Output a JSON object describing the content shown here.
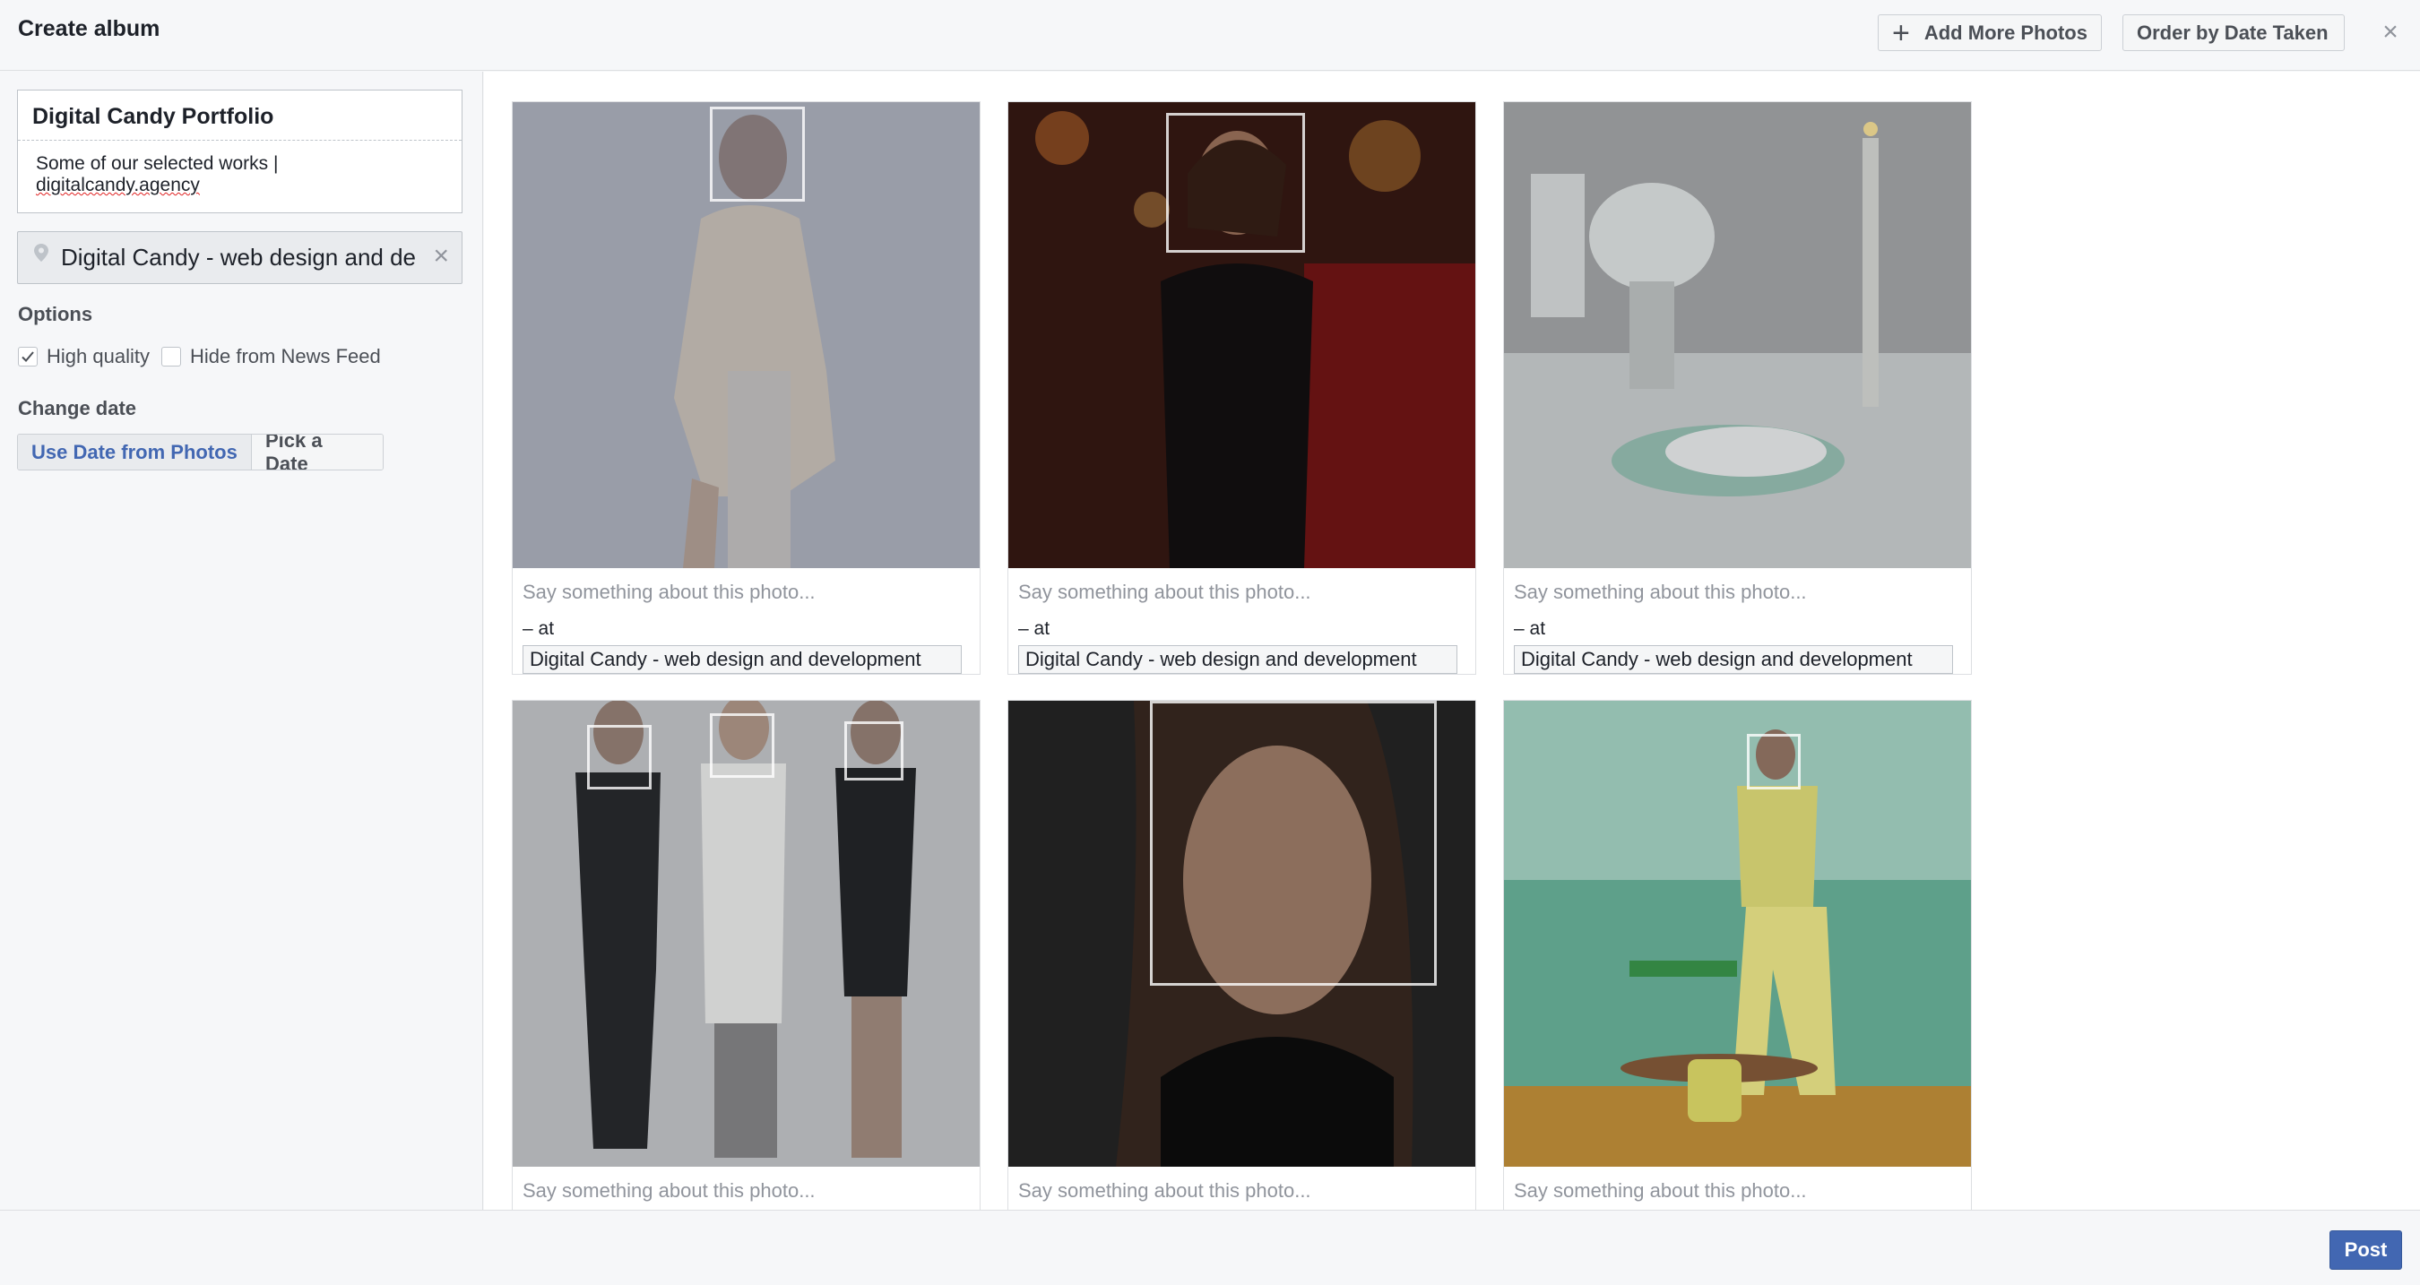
{
  "header": {
    "title": "Create album",
    "add_more_photos": "Add More Photos",
    "order_by_date": "Order by Date Taken",
    "close": "×"
  },
  "sidebar": {
    "album_name": "Digital Candy Portfolio",
    "album_desc_line1": "Some of our selected works |",
    "album_desc_line2": "digitalcandy.agency",
    "location": "Digital Candy - web design and de",
    "location_clear": "×",
    "options_label": "Options",
    "high_quality": {
      "label": "High quality",
      "checked": true
    },
    "hide_news_feed": {
      "label": "Hide from News Feed",
      "checked": false
    },
    "change_date_label": "Change date",
    "use_date_from_photos": "Use Date from Photos",
    "pick_a_date": "Pick a Date"
  },
  "photos": [
    {
      "caption_placeholder": "Say something about this photo...",
      "at": "– at",
      "place": "Digital Candy - web design and development"
    },
    {
      "caption_placeholder": "Say something about this photo...",
      "at": "– at",
      "place": "Digital Candy - web design and development"
    },
    {
      "caption_placeholder": "Say something about this photo...",
      "at": "– at",
      "place": "Digital Candy - web design and development"
    },
    {
      "caption_placeholder": "Say something about this photo..."
    },
    {
      "caption_placeholder": "Say something about this photo..."
    },
    {
      "caption_placeholder": "Say something about this photo..."
    }
  ],
  "footer": {
    "post": "Post"
  },
  "colors": {
    "accent": "#4267b2",
    "panel": "#f6f7f9",
    "border": "#dddfe2"
  }
}
